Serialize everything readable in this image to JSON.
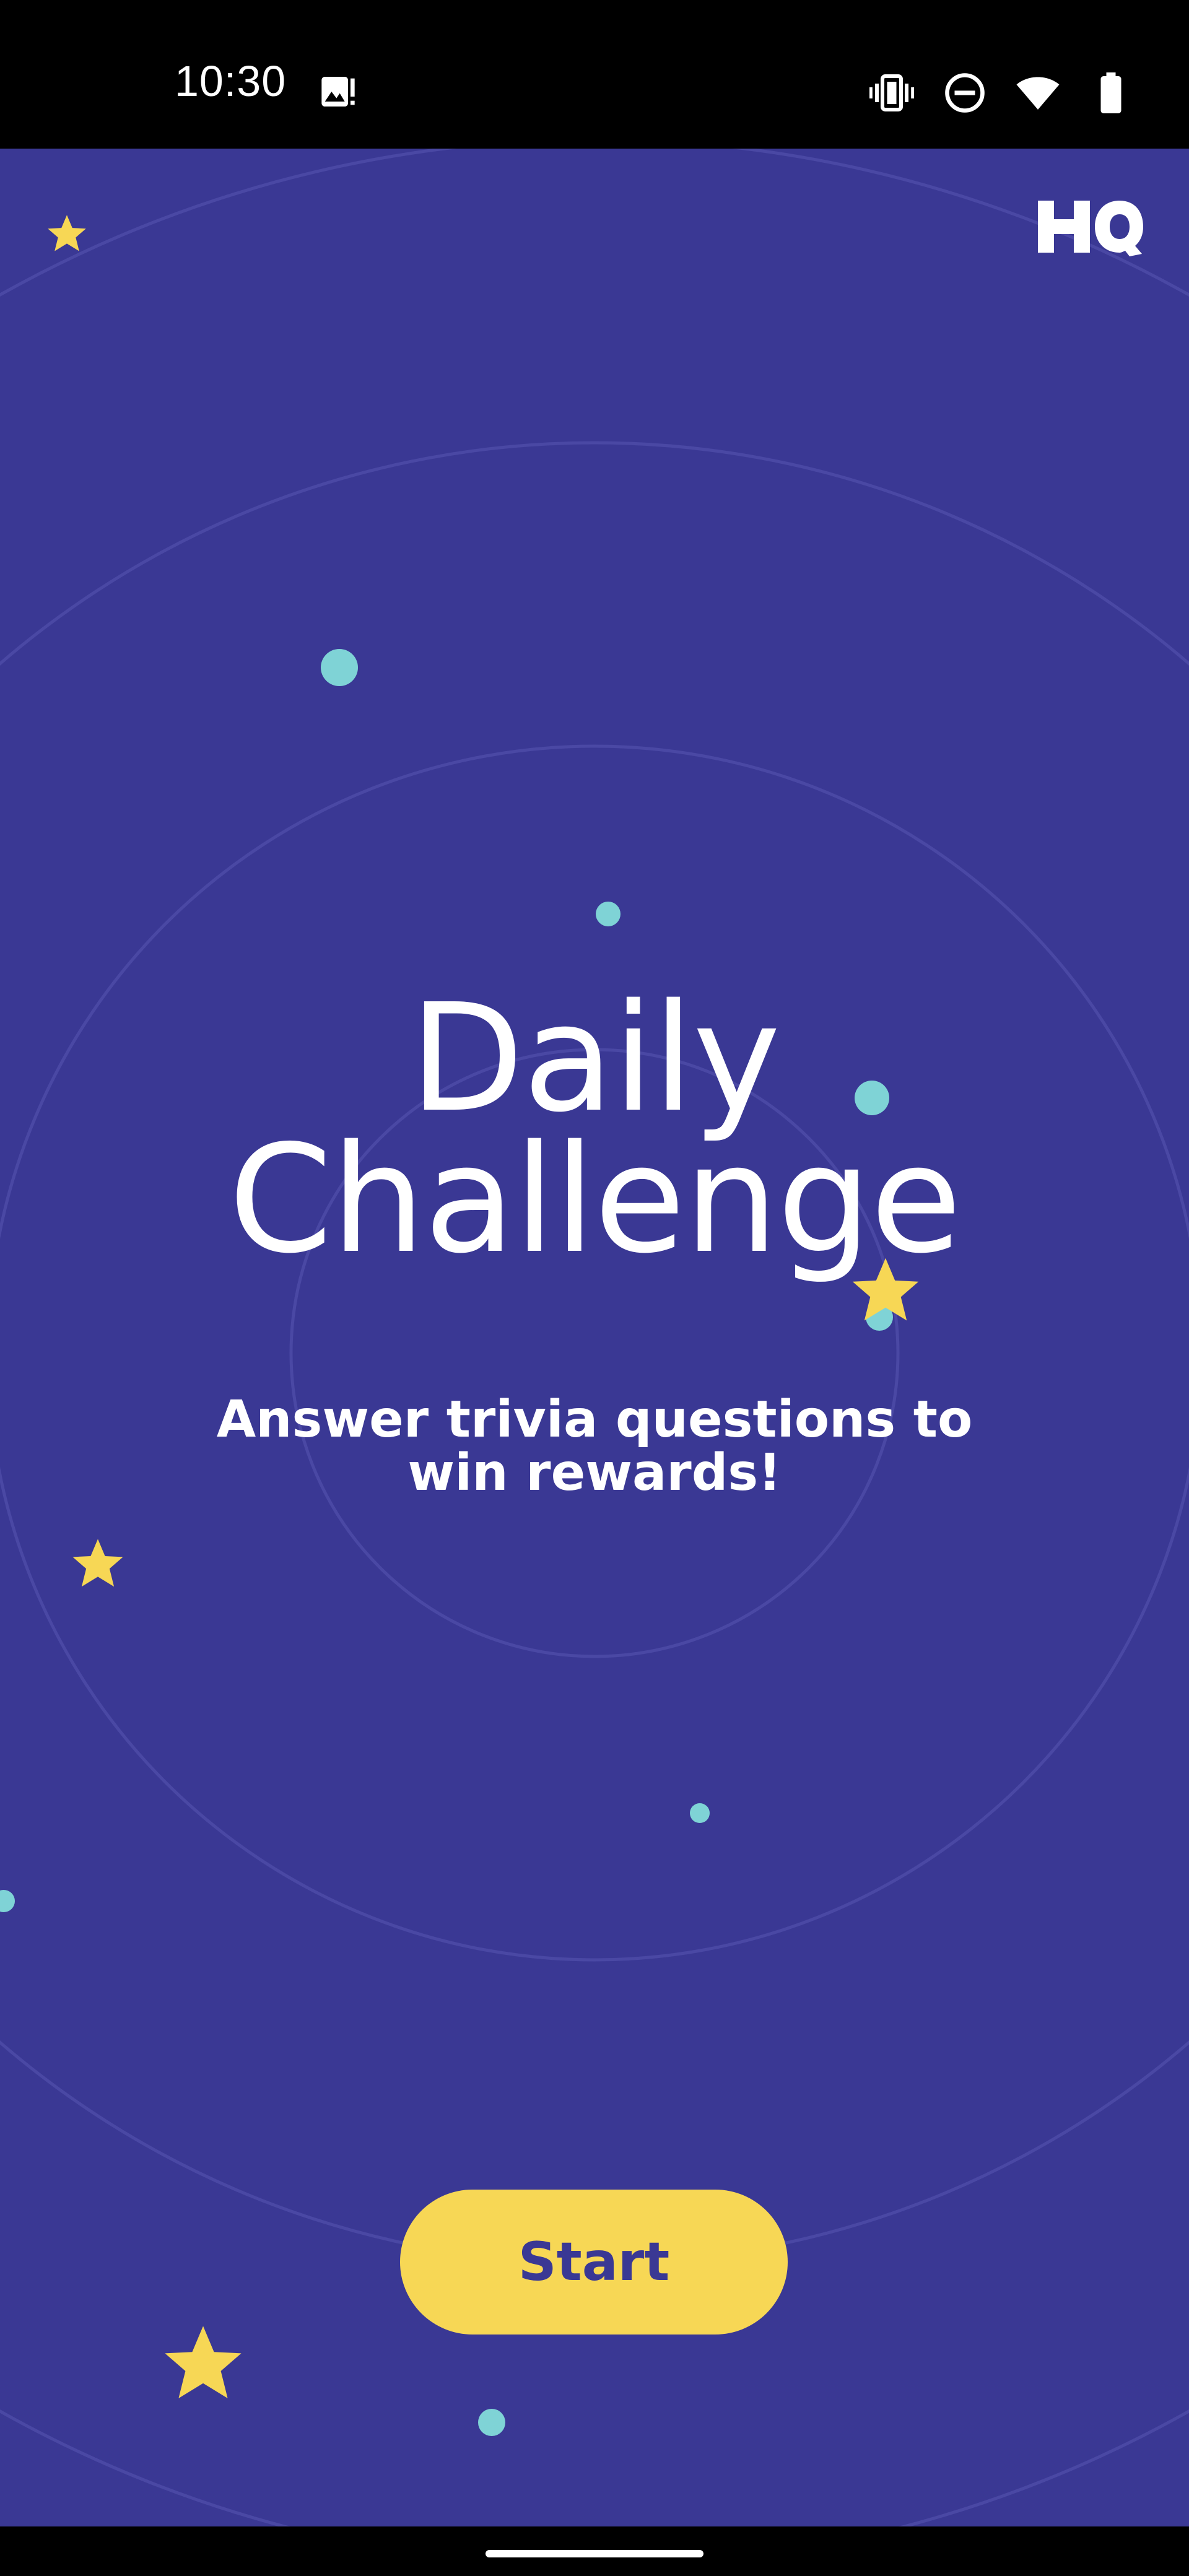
{
  "status_bar": {
    "time": "10:30",
    "icons": [
      "image-alert-icon",
      "vibrate-icon",
      "do-not-disturb-icon",
      "wifi-icon",
      "battery-icon"
    ]
  },
  "app": {
    "logo_text": "HQ",
    "title_line1": "Daily",
    "title_line2": "Challenge",
    "subtitle_line1": "Answer trivia questions to",
    "subtitle_line2": "win rewards!",
    "start_label": "Start"
  },
  "colors": {
    "background": "#3a3894",
    "accent_yellow": "#f7d755",
    "dot_teal": "#7fd3d6",
    "text": "#ffffff",
    "button_text": "#3a3894"
  },
  "decorations": {
    "stars": [
      "star-icon",
      "star-icon",
      "star-icon",
      "star-icon",
      "star-icon"
    ],
    "dots": [
      "dot",
      "dot",
      "dot",
      "dot",
      "dot",
      "dot",
      "dot",
      "dot"
    ]
  }
}
